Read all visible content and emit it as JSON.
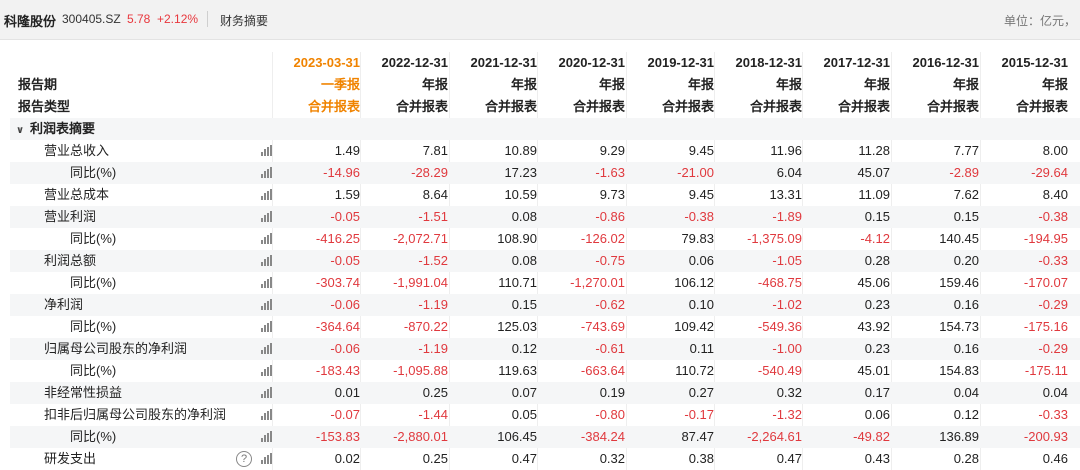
{
  "header": {
    "name": "科隆股份",
    "code": "300405.SZ",
    "price": "5.78",
    "change": "+2.12%",
    "tab": "财务摘要",
    "unit": "单位：亿元，"
  },
  "columns": {
    "dates": [
      "2023-03-31",
      "2022-12-31",
      "2021-12-31",
      "2020-12-31",
      "2019-12-31",
      "2018-12-31",
      "2017-12-31",
      "2016-12-31",
      "2015-12-31"
    ],
    "periods": [
      "一季报",
      "年报",
      "年报",
      "年报",
      "年报",
      "年报",
      "年报",
      "年报",
      "年报"
    ],
    "types": [
      "合并报表",
      "合并报表",
      "合并报表",
      "合并报表",
      "合并报表",
      "合并报表",
      "合并报表",
      "合并报表",
      "合并报表"
    ]
  },
  "labels": {
    "period_label": "报告期",
    "type_label": "报告类型",
    "section_title": "利润表摘要"
  },
  "rows": [
    {
      "label": "营业总收入",
      "indent": 1,
      "values": [
        "1.49",
        "7.81",
        "10.89",
        "9.29",
        "9.45",
        "11.96",
        "11.28",
        "7.77",
        "8.00"
      ]
    },
    {
      "label": "同比(%)",
      "indent": 2,
      "values": [
        "-14.96",
        "-28.29",
        "17.23",
        "-1.63",
        "-21.00",
        "6.04",
        "45.07",
        "-2.89",
        "-29.64"
      ]
    },
    {
      "label": "营业总成本",
      "indent": 1,
      "values": [
        "1.59",
        "8.64",
        "10.59",
        "9.73",
        "9.45",
        "13.31",
        "11.09",
        "7.62",
        "8.40"
      ]
    },
    {
      "label": "营业利润",
      "indent": 1,
      "values": [
        "-0.05",
        "-1.51",
        "0.08",
        "-0.86",
        "-0.38",
        "-1.89",
        "0.15",
        "0.15",
        "-0.38"
      ]
    },
    {
      "label": "同比(%)",
      "indent": 2,
      "values": [
        "-416.25",
        "-2,072.71",
        "108.90",
        "-126.02",
        "79.83",
        "-1,375.09",
        "-4.12",
        "140.45",
        "-194.95"
      ]
    },
    {
      "label": "利润总额",
      "indent": 1,
      "values": [
        "-0.05",
        "-1.52",
        "0.08",
        "-0.75",
        "0.06",
        "-1.05",
        "0.28",
        "0.20",
        "-0.33"
      ]
    },
    {
      "label": "同比(%)",
      "indent": 2,
      "values": [
        "-303.74",
        "-1,991.04",
        "110.71",
        "-1,270.01",
        "106.12",
        "-468.75",
        "45.06",
        "159.46",
        "-170.07"
      ]
    },
    {
      "label": "净利润",
      "indent": 1,
      "values": [
        "-0.06",
        "-1.19",
        "0.15",
        "-0.62",
        "0.10",
        "-1.02",
        "0.23",
        "0.16",
        "-0.29"
      ]
    },
    {
      "label": "同比(%)",
      "indent": 2,
      "values": [
        "-364.64",
        "-870.22",
        "125.03",
        "-743.69",
        "109.42",
        "-549.36",
        "43.92",
        "154.73",
        "-175.16"
      ]
    },
    {
      "label": "归属母公司股东的净利润",
      "indent": 1,
      "values": [
        "-0.06",
        "-1.19",
        "0.12",
        "-0.61",
        "0.11",
        "-1.00",
        "0.23",
        "0.16",
        "-0.29"
      ]
    },
    {
      "label": "同比(%)",
      "indent": 2,
      "values": [
        "-183.43",
        "-1,095.88",
        "119.63",
        "-663.64",
        "110.72",
        "-540.49",
        "45.01",
        "154.83",
        "-175.11"
      ]
    },
    {
      "label": "非经常性损益",
      "indent": 1,
      "values": [
        "0.01",
        "0.25",
        "0.07",
        "0.19",
        "0.27",
        "0.32",
        "0.17",
        "0.04",
        "0.04"
      ]
    },
    {
      "label": "扣非后归属母公司股东的净利润",
      "indent": 1,
      "values": [
        "-0.07",
        "-1.44",
        "0.05",
        "-0.80",
        "-0.17",
        "-1.32",
        "0.06",
        "0.12",
        "-0.33"
      ]
    },
    {
      "label": "同比(%)",
      "indent": 2,
      "values": [
        "-153.83",
        "-2,880.01",
        "106.45",
        "-384.24",
        "87.47",
        "-2,264.61",
        "-49.82",
        "136.89",
        "-200.93"
      ]
    },
    {
      "label": "研发支出",
      "indent": 1,
      "help": true,
      "values": [
        "0.02",
        "0.25",
        "0.47",
        "0.32",
        "0.38",
        "0.47",
        "0.43",
        "0.28",
        "0.46"
      ]
    }
  ],
  "icons": {
    "collapse": "chevron-down-icon",
    "chart": "bar-chart-icon",
    "help": "question-circle-icon"
  },
  "colors": {
    "negative": "#e0393e",
    "highlight": "#f08300",
    "price_up": "#e8373d"
  }
}
